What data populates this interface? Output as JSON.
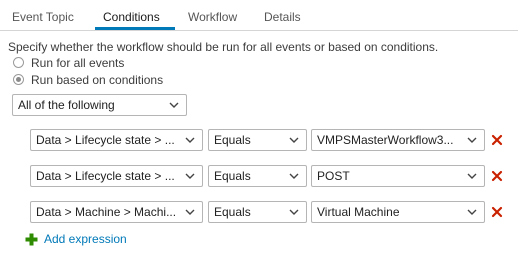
{
  "tabs": [
    {
      "label": "Event Topic"
    },
    {
      "label": "Conditions"
    },
    {
      "label": "Workflow"
    },
    {
      "label": "Details"
    }
  ],
  "description": "Specify whether the workflow should be run for all events or based on conditions.",
  "radios": [
    {
      "label": "Run for all events",
      "checked": false
    },
    {
      "label": "Run based on conditions",
      "checked": true
    }
  ],
  "match_select": {
    "value": "All of the following"
  },
  "conditions": [
    {
      "field": "Data > Lifecycle state > ...",
      "operator": "Equals",
      "value": "VMPSMasterWorkflow3..."
    },
    {
      "field": "Data > Lifecycle state > ...",
      "operator": "Equals",
      "value": "POST"
    },
    {
      "field": "Data > Machine > Machi...",
      "operator": "Equals",
      "value": "Virtual Machine"
    }
  ],
  "add_expression": {
    "label": "Add expression"
  },
  "colors": {
    "accent": "#0079b8",
    "delete": "#c92100",
    "add": "#2e8b00"
  },
  "icons": {
    "dropdown": "chevron-down-icon",
    "delete": "close-icon",
    "add": "plus-icon"
  }
}
